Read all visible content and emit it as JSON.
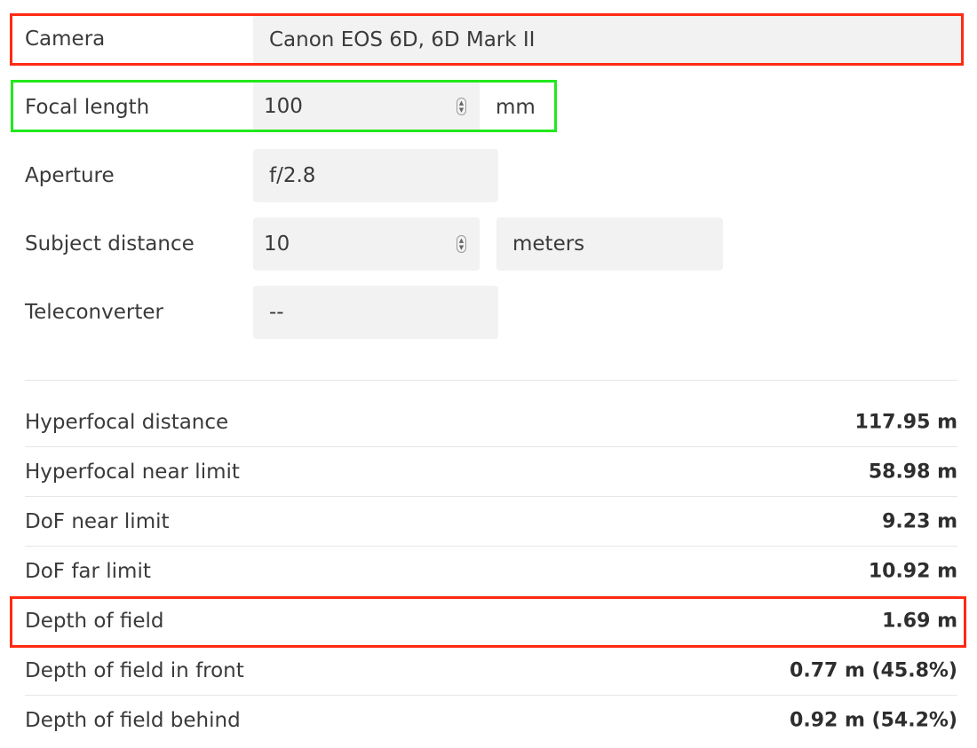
{
  "form": {
    "camera": {
      "label": "Camera",
      "value": "Canon EOS 6D, 6D Mark II"
    },
    "focal_length": {
      "label": "Focal length",
      "value": "100",
      "unit": "mm"
    },
    "aperture": {
      "label": "Aperture",
      "value": "f/2.8"
    },
    "subject_distance": {
      "label": "Subject distance",
      "value": "10",
      "unit": "meters"
    },
    "teleconverter": {
      "label": "Teleconverter",
      "value": "--"
    }
  },
  "results": [
    {
      "label": "Hyperfocal distance",
      "value": "117.95 m"
    },
    {
      "label": "Hyperfocal near limit",
      "value": "58.98 m"
    },
    {
      "label": "DoF near limit",
      "value": "9.23 m"
    },
    {
      "label": "DoF far limit",
      "value": "10.92 m"
    },
    {
      "label": "Depth of field",
      "value": "1.69 m"
    },
    {
      "label": "Depth of field in front",
      "value": "0.77 m (45.8%)"
    },
    {
      "label": "Depth of field behind",
      "value": "0.92 m (54.2%)"
    }
  ],
  "colors": {
    "highlight_red": "#ff2a12",
    "highlight_green": "#22e81c",
    "field_background": "#f2f2f2",
    "text": "#3a3a3a"
  }
}
